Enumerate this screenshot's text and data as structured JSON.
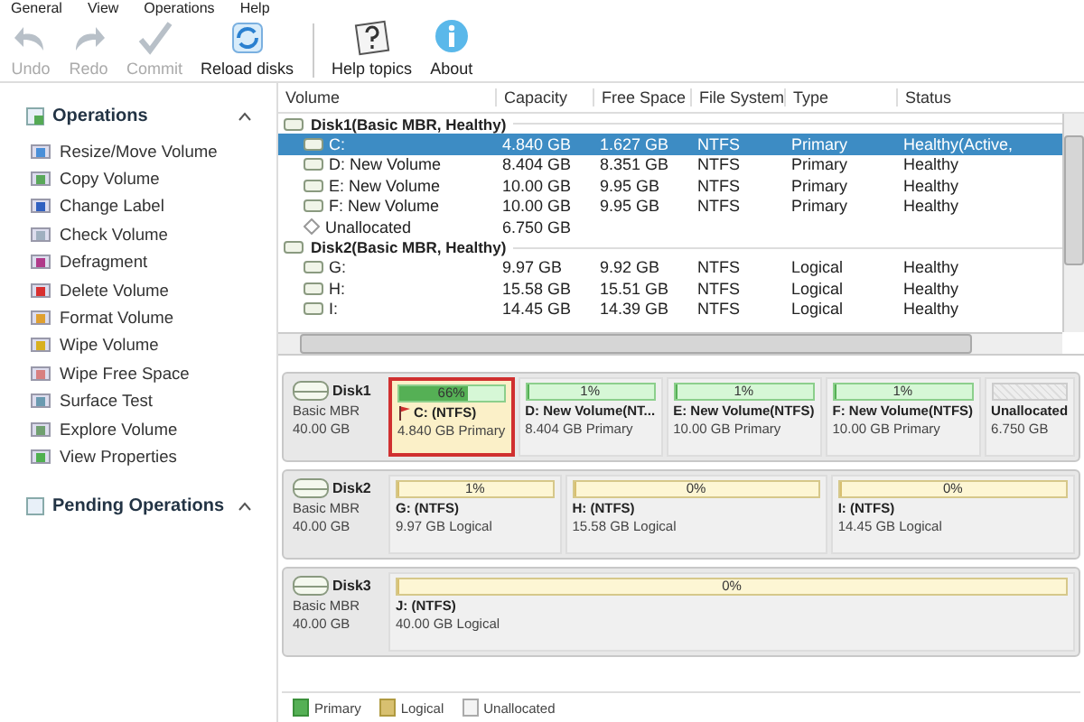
{
  "menu": [
    {
      "label": "General"
    },
    {
      "label": "View"
    },
    {
      "label": "Operations"
    },
    {
      "label": "Help"
    }
  ],
  "toolbar": [
    {
      "label": "Undo",
      "kind": "undo",
      "disabled": true
    },
    {
      "label": "Redo",
      "kind": "redo",
      "disabled": true
    },
    {
      "label": "Commit",
      "kind": "commit",
      "disabled": true
    },
    {
      "label": "Reload disks",
      "kind": "reload",
      "disabled": false
    },
    {
      "label": "Help topics",
      "kind": "help",
      "disabled": false
    },
    {
      "label": "About",
      "kind": "about",
      "disabled": false
    }
  ],
  "sidebar": {
    "sections": [
      {
        "title": "Operations",
        "items": [
          {
            "label": "Resize/Move Volume",
            "color": "#4a8fd8"
          },
          {
            "label": "Copy Volume",
            "color": "#5aa85a"
          },
          {
            "label": "Change Label",
            "color": "#3060c0"
          },
          {
            "label": "Check Volume",
            "color": "#a0b0c0"
          },
          {
            "label": "Defragment",
            "color": "#b03a8a"
          },
          {
            "label": "Delete Volume",
            "color": "#d83030"
          },
          {
            "label": "Format Volume",
            "color": "#e0a030"
          },
          {
            "label": "Wipe Volume",
            "color": "#d8b020"
          },
          {
            "label": "Wipe Free Space",
            "color": "#d88080"
          },
          {
            "label": "Surface Test",
            "color": "#6a9ab0"
          },
          {
            "label": "Explore Volume",
            "color": "#70a070"
          },
          {
            "label": "View Properties",
            "color": "#50b050"
          }
        ]
      },
      {
        "title": "Pending Operations"
      }
    ]
  },
  "table": {
    "columns": [
      "Volume",
      "Capacity",
      "Free Space",
      "File System",
      "Type",
      "Status"
    ],
    "rows": [
      {
        "kind": "disk",
        "cells": [
          "Disk1(Basic MBR, Healthy)"
        ]
      },
      {
        "kind": "volume",
        "cells": [
          "C:",
          "4.840 GB",
          "1.627 GB",
          "NTFS",
          "Primary",
          "Healthy(Active,"
        ],
        "selected": true
      },
      {
        "kind": "volume",
        "cells": [
          "D: New Volume",
          "8.404 GB",
          "8.351 GB",
          "NTFS",
          "Primary",
          "Healthy"
        ],
        "selected": false
      },
      {
        "kind": "volume",
        "cells": [
          "E: New Volume",
          "10.00 GB",
          "9.95 GB",
          "NTFS",
          "Primary",
          "Healthy"
        ],
        "selected": false
      },
      {
        "kind": "volume",
        "cells": [
          "F: New Volume",
          "10.00 GB",
          "9.95 GB",
          "NTFS",
          "Primary",
          "Healthy"
        ],
        "selected": false
      },
      {
        "kind": "unallocated",
        "cells": [
          "Unallocated",
          "6.750 GB"
        ],
        "selected": false
      },
      {
        "kind": "disk",
        "cells": [
          "Disk2(Basic MBR, Healthy)"
        ]
      },
      {
        "kind": "volume",
        "cells": [
          "G:",
          "9.97 GB",
          "9.92 GB",
          "NTFS",
          "Logical",
          "Healthy"
        ],
        "selected": false
      },
      {
        "kind": "volume",
        "cells": [
          "H:",
          "15.58 GB",
          "15.51 GB",
          "NTFS",
          "Logical",
          "Healthy"
        ],
        "selected": false
      },
      {
        "kind": "volume",
        "cells": [
          "I:",
          "14.45 GB",
          "14.39 GB",
          "NTFS",
          "Logical",
          "Healthy"
        ],
        "selected": false
      }
    ]
  },
  "disks": [
    {
      "name": "Disk1",
      "style": "Basic MBR",
      "size": "40.00 GB",
      "partitions": [
        {
          "kind": "primary",
          "percent": "66%",
          "level": 0.66,
          "name": "C: (NTFS)",
          "detail": "4.840 GB Primary",
          "selected": true,
          "flagged": true
        },
        {
          "kind": "primary",
          "percent": "1%",
          "level": 0.01,
          "name": "D: New Volume(NT...",
          "detail": "8.404 GB Primary",
          "selected": false,
          "flagged": false
        },
        {
          "kind": "primary",
          "percent": "1%",
          "level": 0.01,
          "name": "E: New Volume(NTFS)",
          "detail": "10.00 GB Primary",
          "selected": false,
          "flagged": false
        },
        {
          "kind": "primary",
          "percent": "1%",
          "level": 0.01,
          "name": "F: New Volume(NTFS)",
          "detail": "10.00 GB Primary",
          "selected": false,
          "flagged": false
        },
        {
          "kind": "unallocated",
          "name": "Unallocated",
          "detail": "6.750 GB",
          "selected": false,
          "flagged": false
        }
      ]
    },
    {
      "name": "Disk2",
      "style": "Basic MBR",
      "size": "40.00 GB",
      "partitions": [
        {
          "kind": "logical",
          "percent": "1%",
          "level": 0.01,
          "name": "G: (NTFS)",
          "detail": "9.97 GB Logical",
          "selected": false,
          "flagged": false
        },
        {
          "kind": "logical",
          "percent": "0%",
          "level": 0,
          "name": "H: (NTFS)",
          "detail": "15.58 GB Logical",
          "selected": false,
          "flagged": false
        },
        {
          "kind": "logical",
          "percent": "0%",
          "level": 0,
          "name": "I: (NTFS)",
          "detail": "14.45 GB Logical",
          "selected": false,
          "flagged": false
        }
      ]
    },
    {
      "name": "Disk3",
      "style": "Basic MBR",
      "size": "40.00 GB",
      "partitions": [
        {
          "kind": "logical",
          "percent": "0%",
          "level": 0,
          "name": "J: (NTFS)",
          "detail": "40.00 GB Logical",
          "selected": false,
          "flagged": false
        }
      ]
    }
  ],
  "legend": [
    {
      "kind": "primary",
      "label": "Primary"
    },
    {
      "kind": "logical",
      "label": "Logical"
    },
    {
      "kind": "unallocated",
      "label": "Unallocated"
    }
  ]
}
